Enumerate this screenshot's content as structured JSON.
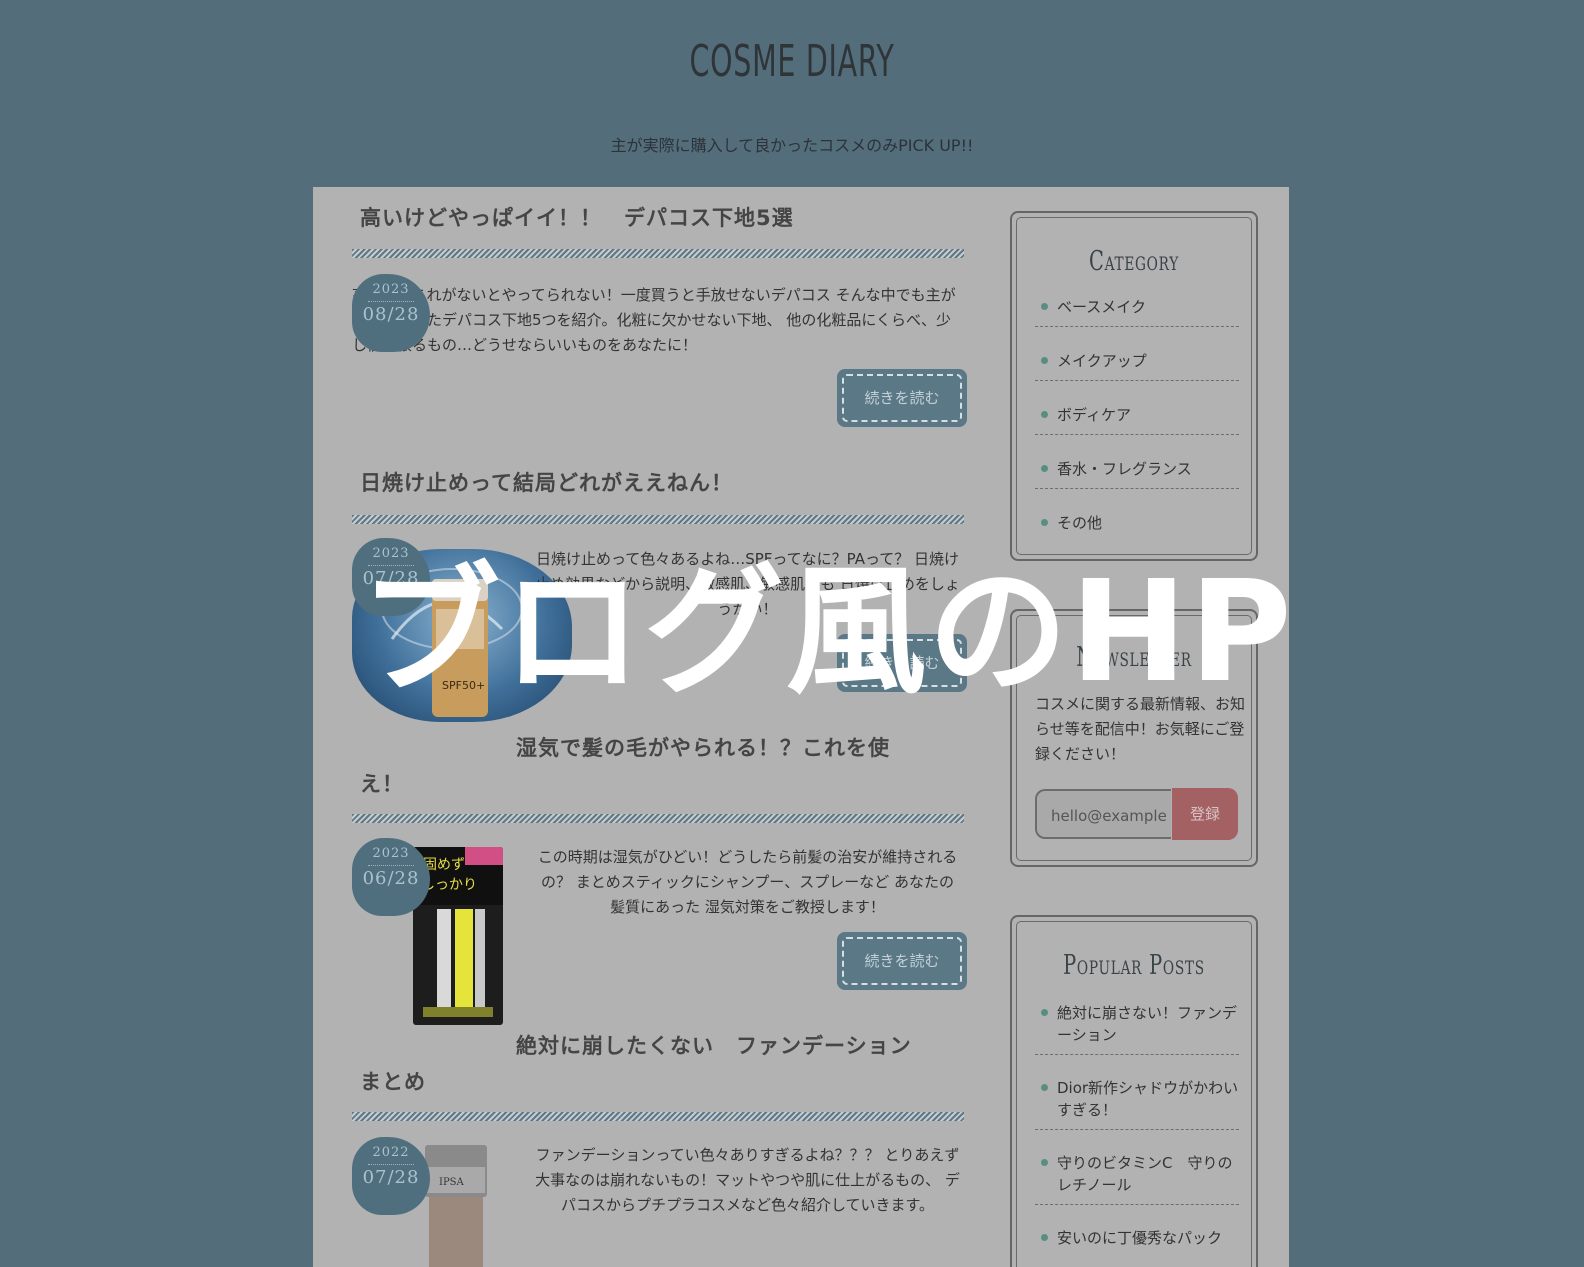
{
  "site": {
    "title": "COSME DIARY",
    "subtitle": "主が実際に購入して良かったコスメのみPICK UP!!"
  },
  "overlay": {
    "title": "ブログ風のHP"
  },
  "articles": [
    {
      "title": "高いけどやっぱイイ！！　デパコス下地5選",
      "year": "2023",
      "date": "08/28",
      "excerpt": "高いけどこれがないとやってられない！一度買うと手放せないデパコス そんな中でも主が特に感動したデパコス下地5つを紹介。化粧に欠かせない下地、 他の化粧品にくらべ、少し値が張るもの…どうせならいいものをあなたに！",
      "read_more": "続きを読む"
    },
    {
      "title": "日焼け止めって結局どれがええねん！",
      "year": "2023",
      "date": "07/28",
      "excerpt": "日焼け止めって色々あるよね…SPFってなに？PAって？ 日焼け止め効果などから説明、敏感肌、敏感肌にも 日焼け止めをしょうかい！",
      "read_more": "続きを読む"
    },
    {
      "title": "湿気で髪の毛がやられる！？これを使え！",
      "title_line1": "湿気で髪の毛がやられる！？これを使",
      "title_line2": "え！",
      "year": "2023",
      "date": "06/28",
      "excerpt": "この時期は湿気がひどい！どうしたら前髪の治安が維持されるの？ まとめスティックにシャンプー、スプレーなど あなたの髪質にあった 湿気対策をご教授します！",
      "read_more": "続きを読む"
    },
    {
      "title": "絶対に崩したくない　ファンデーション まとめ",
      "title_line1": "絶対に崩したくない　ファンデーション",
      "title_line2": "まとめ",
      "year": "2022",
      "date": "07/28",
      "excerpt": "ファンデーションってい色々ありすぎるよね？？？ とりあえず大事なのは崩れないもの！マットやつや肌に仕上がるもの、 デパコスからプチプラコスメなど色々紹介していきます。"
    }
  ],
  "sidebar": {
    "category": {
      "title": "Category",
      "items": [
        "ベースメイク",
        "メイクアップ",
        "ボディケア",
        "香水・フレグランス",
        "その他"
      ]
    },
    "newsletter": {
      "title": "Newsletter",
      "text": "コスメに関する最新情報、お知らせ等を配信中！お気軽にご登録ください！",
      "placeholder": "hello@example",
      "button": "登録"
    },
    "popular": {
      "title": "Popular Posts",
      "items": [
        "絶対に崩さない！ファンデーション",
        "Dior新作シャドウがかわいすぎる！",
        "守りのビタミンC　守りのレチノール",
        "安いのに丁優秀なパック"
      ]
    }
  }
}
